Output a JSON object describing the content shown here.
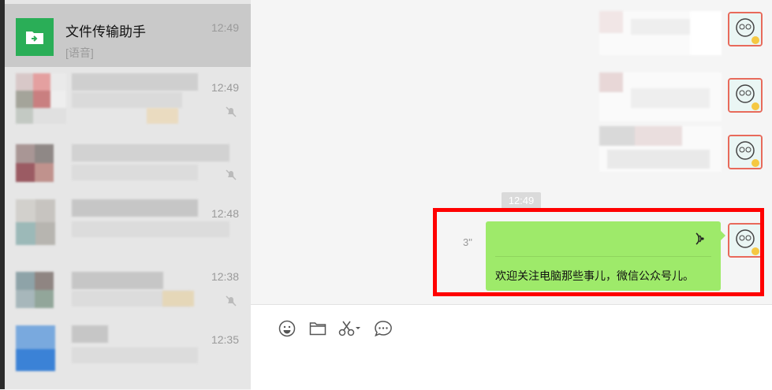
{
  "sidebar": {
    "chats": [
      {
        "name": "文件传输助手",
        "preview": "[语音]",
        "time": "12:49",
        "active": true,
        "icon": "file-transfer-icon"
      },
      {
        "name": "",
        "preview": "",
        "time": "12:49",
        "muted": true
      },
      {
        "name": "",
        "preview": "",
        "time": "",
        "muted": true
      },
      {
        "name": "",
        "preview": "",
        "time": "12:48",
        "muted": false
      },
      {
        "name": "",
        "preview": "",
        "time": "12:38",
        "muted": true
      },
      {
        "name": "",
        "preview": "",
        "time": "12:35",
        "muted": false
      }
    ]
  },
  "conversation": {
    "timestamp": "12:49",
    "voice_message": {
      "duration": "3\"",
      "transcript": "欢迎关注电脑那些事儿，微信公众号儿。",
      "icon": "voice-wave-icon"
    }
  },
  "composer": {
    "tools": [
      {
        "name": "emoji-icon"
      },
      {
        "name": "folder-icon"
      },
      {
        "name": "screenshot-scissors-icon"
      },
      {
        "name": "chat-history-icon"
      }
    ]
  },
  "colors": {
    "accent_green": "#2aae57",
    "bubble_green": "#9eea6a",
    "highlight_red": "#ff0000"
  }
}
